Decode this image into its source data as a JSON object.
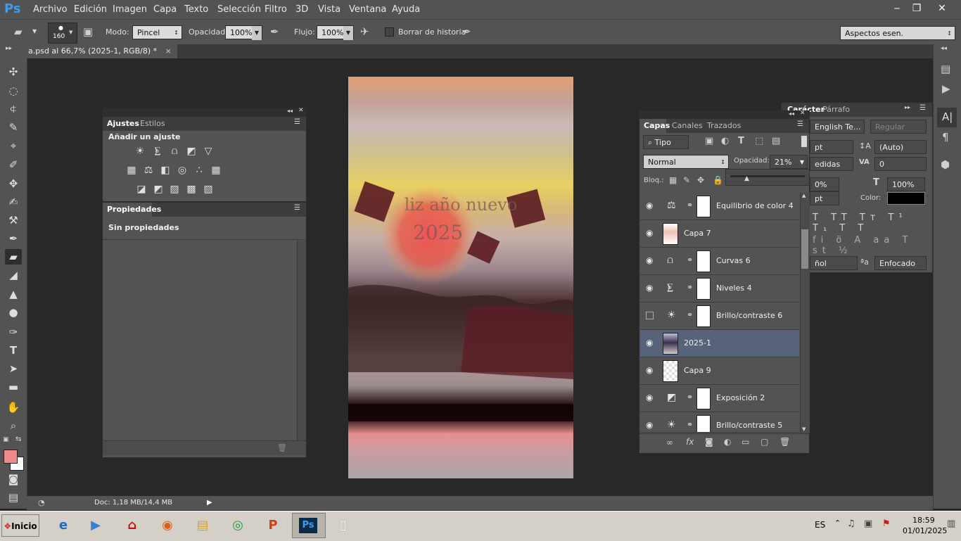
{
  "menubar": {
    "logo": "Ps",
    "items": [
      "Archivo",
      "Edición",
      "Imagen",
      "Capa",
      "Texto",
      "Selección",
      "Filtro",
      "3D",
      "Vista",
      "Ventana",
      "Ayuda"
    ]
  },
  "options": {
    "brush_size": "160",
    "mode_label": "Modo:",
    "mode_value": "Pincel",
    "opacity_label": "Opacidad:",
    "opacity_value": "100%",
    "flow_label": "Flujo:",
    "flow_value": "100%",
    "erase_history_label": "Borrar de historia",
    "workspace": "Aspectos esen."
  },
  "document": {
    "tab_title": "a.psd al 66,7% (2025-1, RGB/8) *",
    "tab_close": "×",
    "canvas_text_1": "liz año nuevo",
    "canvas_text_2": "2025",
    "status": "Doc: 1,18 MB/14,4 MB"
  },
  "adjustments_panel": {
    "tabs": [
      "Ajustes",
      "Estilos"
    ],
    "heading": "Añadir un ajuste"
  },
  "properties_panel": {
    "tab": "Propiedades",
    "body": "Sin propiedades"
  },
  "layers_panel": {
    "tabs": [
      "Capas",
      "Canales",
      "Trazados"
    ],
    "filter_kind": "Tipo",
    "blend_mode": "Normal",
    "opacity_label": "Opacidad:",
    "opacity_value": "21%",
    "lock_label": "Bloq.:",
    "layers": [
      {
        "name": "Equilibrio de color 4",
        "kind": "adjustment",
        "icon": "balance-icon",
        "visible": true,
        "selected": false
      },
      {
        "name": "Capa 7",
        "kind": "pixel",
        "visible": true,
        "selected": false
      },
      {
        "name": "Curvas 6",
        "kind": "adjustment",
        "icon": "curves-icon",
        "visible": true,
        "selected": false
      },
      {
        "name": "Niveles 4",
        "kind": "adjustment",
        "icon": "levels-icon",
        "visible": true,
        "selected": false
      },
      {
        "name": "Brillo/contraste 6",
        "kind": "adjustment",
        "icon": "brightness-icon",
        "visible": false,
        "selected": false
      },
      {
        "name": "2025-1",
        "kind": "pixel",
        "visible": true,
        "selected": true
      },
      {
        "name": "Capa 9",
        "kind": "pixel",
        "visible": true,
        "selected": false
      },
      {
        "name": "Exposición 2",
        "kind": "adjustment",
        "icon": "exposure-icon",
        "visible": true,
        "selected": false
      },
      {
        "name": "Brillo/contraste 5",
        "kind": "adjustment",
        "icon": "brightness-icon",
        "visible": true,
        "selected": false
      }
    ]
  },
  "character_panel": {
    "tabs": [
      "Carácter",
      "Párrafo"
    ],
    "font": "English Te...",
    "style": "Regular",
    "size": "pt",
    "leading": "(Auto)",
    "kerning": "edidas",
    "tracking": "0",
    "vscale": "0%",
    "hscale": "100%",
    "baseline": "pt",
    "color_label": "Color:",
    "language": "ñol",
    "antialias": "Enfocado"
  },
  "taskbar": {
    "start": "Inicio",
    "lang": "ES",
    "time": "18:59",
    "date": "01/01/2025"
  },
  "colors": {
    "fg_swatch": "#f08b8b",
    "bg_swatch": "#ffffff",
    "selected_layer": "#56637a"
  }
}
